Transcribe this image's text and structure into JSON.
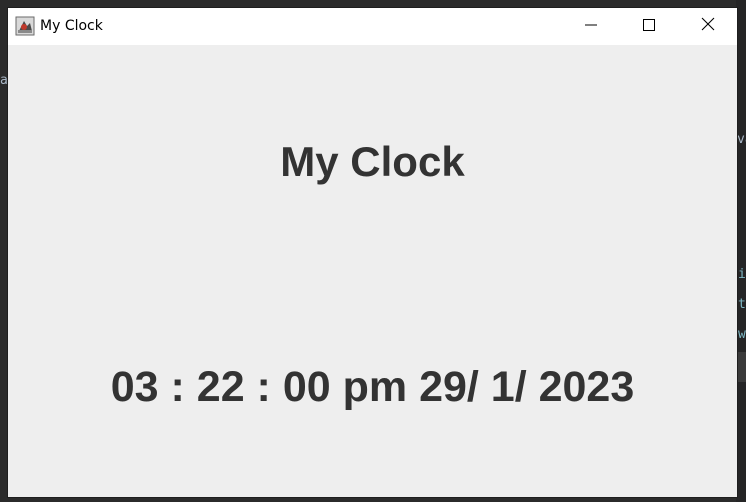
{
  "background": {
    "fragments": {
      "left_a": "a",
      "right_va": "va",
      "right_i": "i",
      "right_t": "t",
      "right_w": "w"
    }
  },
  "window": {
    "title": "My Clock",
    "controls": {
      "minimize": "minimize",
      "maximize": "maximize",
      "close": "close"
    }
  },
  "clock": {
    "heading": "My Clock",
    "time": "03 : 22 : 00",
    "ampm": "pm",
    "date": "29/ 1/ 2023"
  },
  "colors": {
    "window_bg": "#eeeeee",
    "titlebar_bg": "#ffffff",
    "text": "#333333",
    "desktop_bg": "#2b2b2b"
  }
}
